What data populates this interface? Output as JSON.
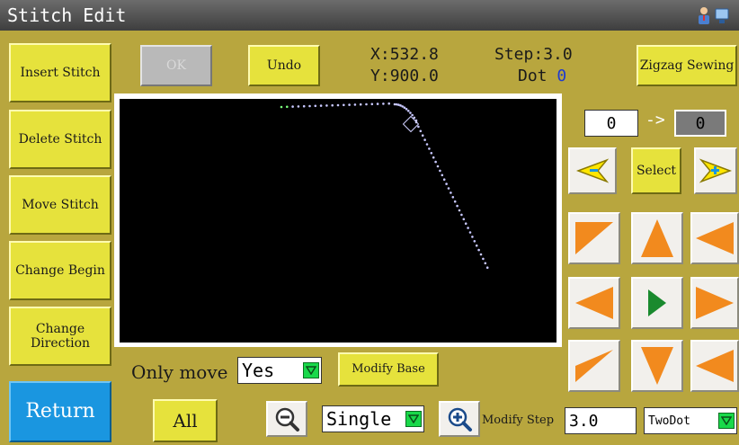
{
  "window": {
    "title": "Stitch Edit"
  },
  "left_buttons": {
    "insert": "Insert Stitch",
    "delete": "Delete Stitch",
    "move": "Move Stitch",
    "change_begin": "Change Begin",
    "change_direction": "Change Direction",
    "return": "Return"
  },
  "top": {
    "ok": "OK",
    "undo": "Undo",
    "x_label": "X:",
    "x_value": "532.8",
    "y_label": "Y:",
    "y_value": "900.0",
    "step_label": "Step:",
    "step_value": "3.0",
    "dot_label": "Dot",
    "dot_value": "0",
    "zigzag": "Zigzag Sewing"
  },
  "range": {
    "from": "0",
    "arrow": "->",
    "to": "0"
  },
  "select_label": "Select",
  "bottom": {
    "only_move_label": "Only move",
    "only_move_value": "Yes",
    "modify_base": "Modify Base",
    "all": "All",
    "mode_value": "Single",
    "modify_step_label": "Modify Step",
    "modify_step_value": "3.0",
    "dot_mode_value": "TwoDot"
  },
  "colors": {
    "background": "#b8a63e",
    "button": "#e6e23c",
    "return_button": "#1a96e0",
    "arrow_orange": "#f28a1e",
    "arrow_green": "#1a8a2e",
    "stitch_points": "#c8c8ff"
  },
  "icons": [
    "user-icon",
    "monitor-icon",
    "minus-arrow-icon",
    "plus-arrow-icon",
    "zoom-out-icon",
    "zoom-in-icon",
    "dropdown-icon"
  ]
}
